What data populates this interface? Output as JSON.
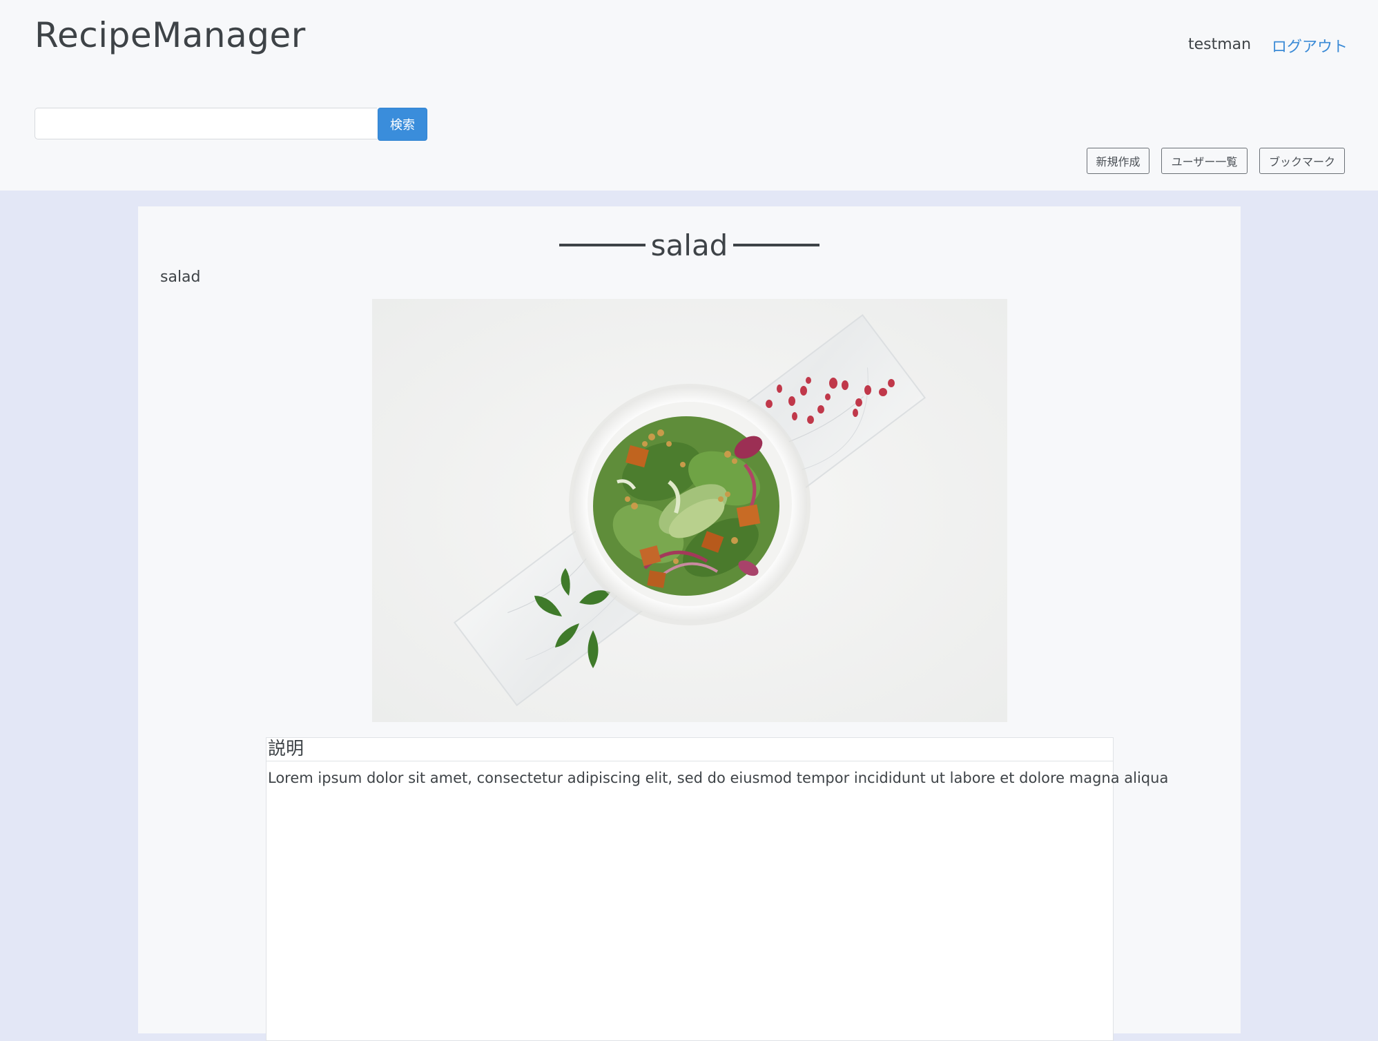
{
  "header": {
    "brand": "RecipeManager",
    "username": "testman",
    "logout_label": "ログアウト",
    "search": {
      "value": "",
      "placeholder": "",
      "button_label": "検索"
    },
    "nav": {
      "new_label": "新規作成",
      "users_label": "ユーザー一覧",
      "bookmark_label": "ブックマーク"
    }
  },
  "recipe": {
    "title": "salad",
    "subtitle": "salad",
    "image": "salad-bowl-photo",
    "description_heading": "説明",
    "description_text": "Lorem ipsum dolor sit amet, consectetur adipiscing elit, sed do eiusmod tempor incididunt ut labore et dolore magna aliqua"
  },
  "colors": {
    "header_bg": "#f7f8fa",
    "page_bg": "#e3e7f6",
    "accent": "#3a8ddb",
    "link": "#3a8ad6"
  }
}
